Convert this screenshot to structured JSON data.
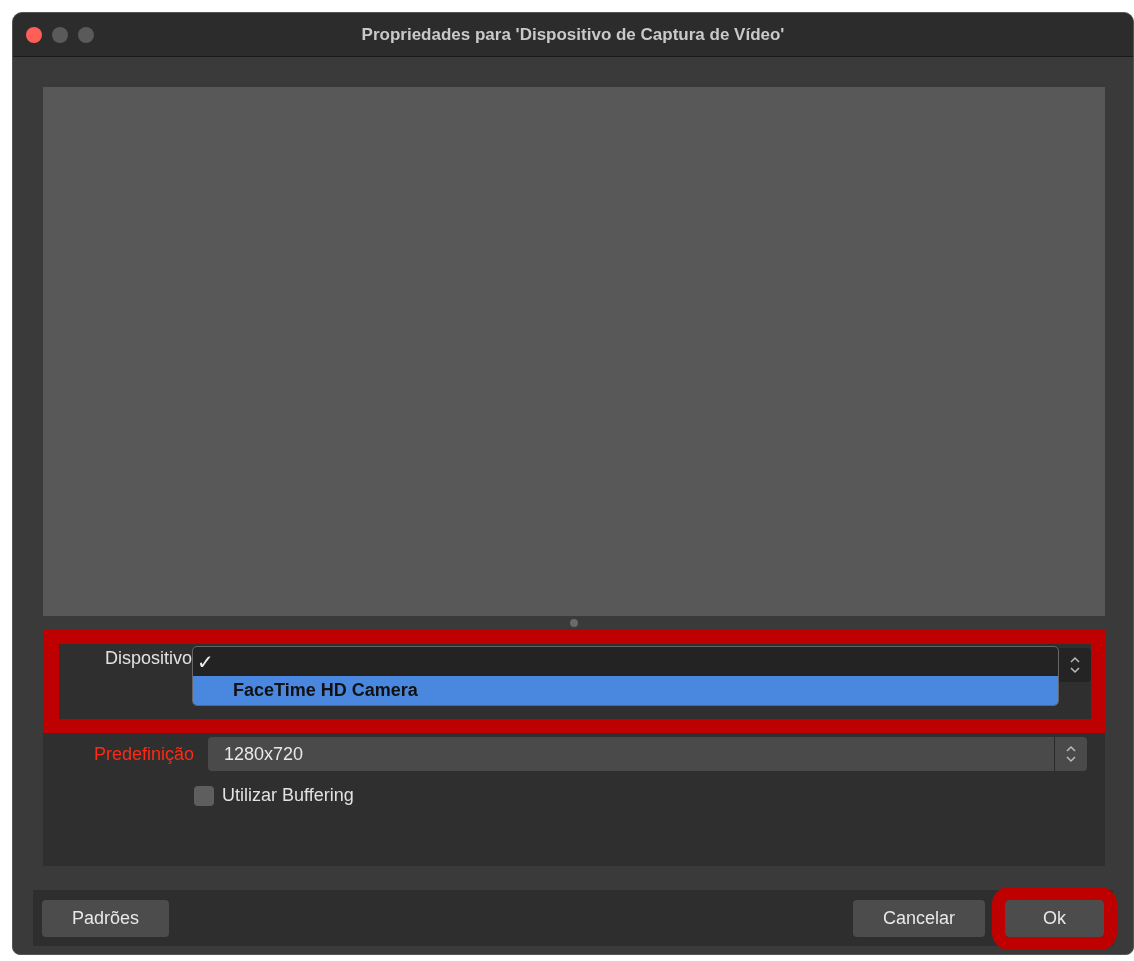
{
  "window": {
    "title": "Propriedades para 'Dispositivo de Captura de Vídeo'"
  },
  "preview": {
    "kind": "empty"
  },
  "device": {
    "label": "Dispositivo",
    "highlighted": true,
    "open": true,
    "options": [
      {
        "text": "✓",
        "selected": false
      },
      {
        "text": "FaceTime HD Camera",
        "selected": true
      }
    ]
  },
  "preset": {
    "label": "Predefinição",
    "invalid": true,
    "value": "1280x720"
  },
  "buffering": {
    "label": "Utilizar Buffering",
    "checked": false
  },
  "buttons": [
    {
      "label": "Padrões",
      "highlighted": false
    },
    {
      "label": "Cancelar",
      "highlighted": false
    },
    {
      "label": "Ok",
      "highlighted": true
    }
  ]
}
